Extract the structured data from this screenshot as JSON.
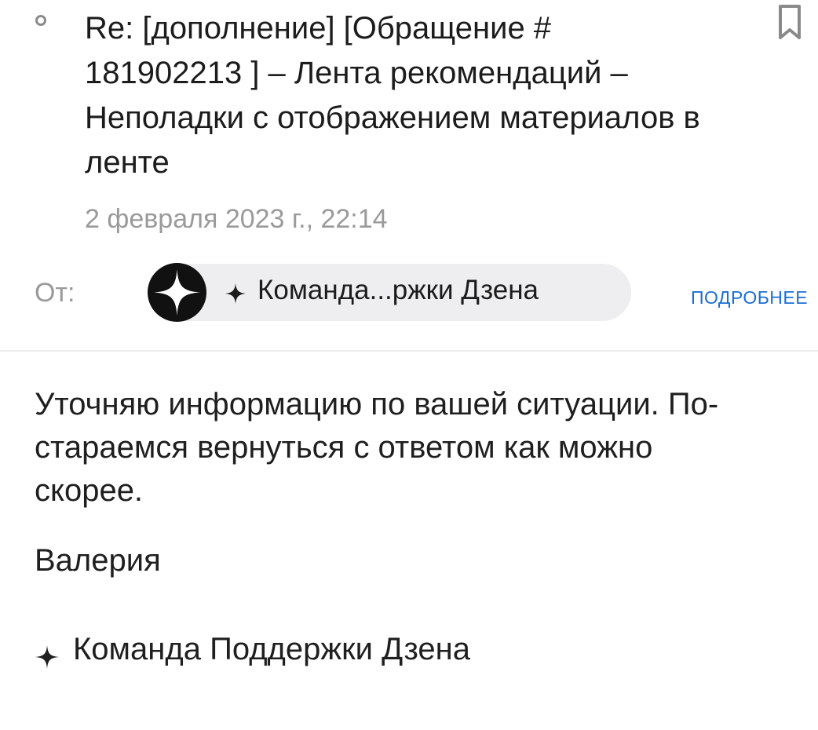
{
  "message": {
    "subject": "Re: [дополнение] [Обращение # 181902213 ] – Лента рекомендаций – Неполадки с отображением материалов в ленте",
    "date": "2 февраля 2023 г., 22:14",
    "from_label": "От:",
    "sender_name": "Команда...ржки Дзена",
    "details_label": "ПОДРОБНЕЕ"
  },
  "body": {
    "text": "Уточняю информацию по вашей ситуации. По-\nстараемся вернуться с ответом как можно\nскорее.",
    "signature_name": "Валерия",
    "signature_team": "Команда Поддержки Дзена"
  },
  "icons": {
    "unread": "unread-circle-icon",
    "bookmark": "bookmark-icon",
    "avatar": "zen-logo-icon",
    "sparkle": "sparkle-icon"
  },
  "colors": {
    "link": "#1b6fd6",
    "muted": "#9a9a9a",
    "chip_bg": "#eeeef1"
  }
}
